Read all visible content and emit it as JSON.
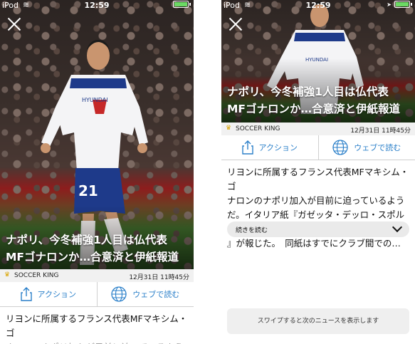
{
  "status_bar": {
    "carrier": "iPod",
    "time": "12:59"
  },
  "article": {
    "headline_line1": "ナポリ、今冬補強1人目は仏代表",
    "headline_line2": "MFゴナロンか…合意済と伊紙報道",
    "source": "SOCCER KING",
    "date": "12月31日 11時45分",
    "jersey_number": "21",
    "body_line1": "リヨンに所属するフランス代表MFマキシム・ゴ",
    "body_line2": "ナロンのナポリ加入が目前に迫っているよう",
    "body_line3": "だ。イタリア紙『ガゼッタ・デッロ・スポルト",
    "body_line4": "』が報じた。　同紙はすでにクラブ間での…"
  },
  "actions": {
    "share_label": "アクション",
    "web_label": "ウェブで読む"
  },
  "more_label": "続きを読む",
  "swipe_hint": "スワイプすると次のニュースを表示します",
  "colors": {
    "accent": "#2a7fc9",
    "meta_bg": "#f1f1f1"
  }
}
